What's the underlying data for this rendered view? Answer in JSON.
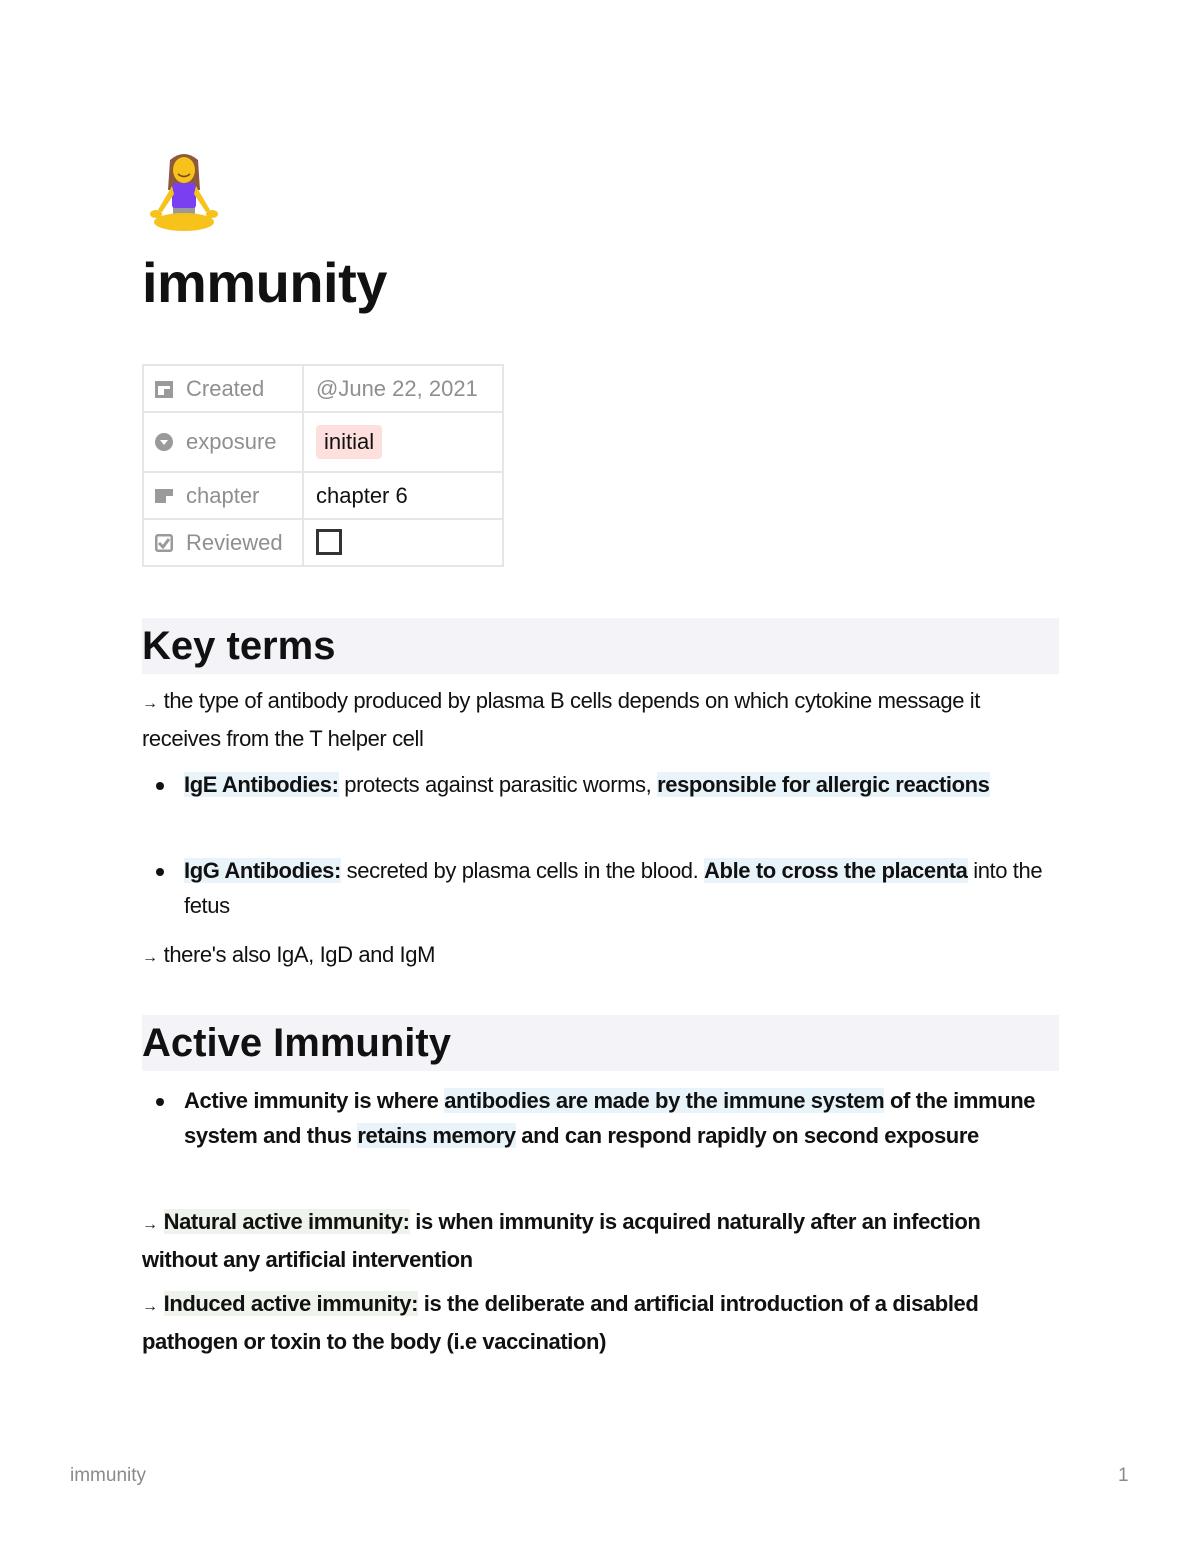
{
  "page": {
    "icon": "woman-in-lotus-position-emoji",
    "title": "immunity"
  },
  "properties": [
    {
      "icon": "calendar-icon",
      "label": "Created",
      "value": "@June 22, 2021",
      "type": "date"
    },
    {
      "icon": "select-icon",
      "label": "exposure",
      "value": "initial",
      "type": "select",
      "pill_color": "#fde0dd"
    },
    {
      "icon": "text-icon",
      "label": "chapter",
      "value": "chapter 6",
      "type": "text"
    },
    {
      "icon": "checkbox-icon",
      "label": "Reviewed",
      "value": false,
      "type": "checkbox"
    }
  ],
  "sections": {
    "key_terms": {
      "heading": "Key terms",
      "intro_arrow": "→",
      "intro": "the type of antibody produced by plasma B cells depends on which cytokine message it receives from the T helper cell",
      "bullets": [
        {
          "term": "IgE Antibodies:",
          "text": " protects against parasitic worms, ",
          "highlight": "responsible for allergic reactions",
          "rest": ""
        },
        {
          "term": "IgG Antibodies:",
          "text": " secreted by plasma cells in the blood. ",
          "highlight": "Able to cross the placenta",
          "rest": " into the fetus"
        }
      ],
      "outro_arrow": "→",
      "outro": "there's also IgA, IgD and IgM"
    },
    "active_immunity": {
      "heading": "Active Immunity",
      "bullet": {
        "p1": "Active immunity is where ",
        "h1": "antibodies are made by the immune system",
        "p2": " of the immune system and thus ",
        "h2": "retains memory",
        "p3": " and can respond rapidly on second exposure"
      },
      "natural": {
        "arrow": "→",
        "term": "Natural active immunity:",
        "text": " is when immunity is acquired naturally after an infection without any artificial intervention"
      },
      "induced": {
        "arrow": "→",
        "term": "Induced active immunity:",
        "text": " is the deliberate and artificial introduction of a disabled pathogen or toxin to the body (i.e vaccination)"
      }
    }
  },
  "footer": {
    "title": "immunity",
    "page_number": "1"
  },
  "colors": {
    "heading_bg": "#f4f3f8",
    "highlight_blue": "#e8f3fa",
    "highlight_green": "#eef3ec",
    "muted_text": "#8f8f8f"
  }
}
